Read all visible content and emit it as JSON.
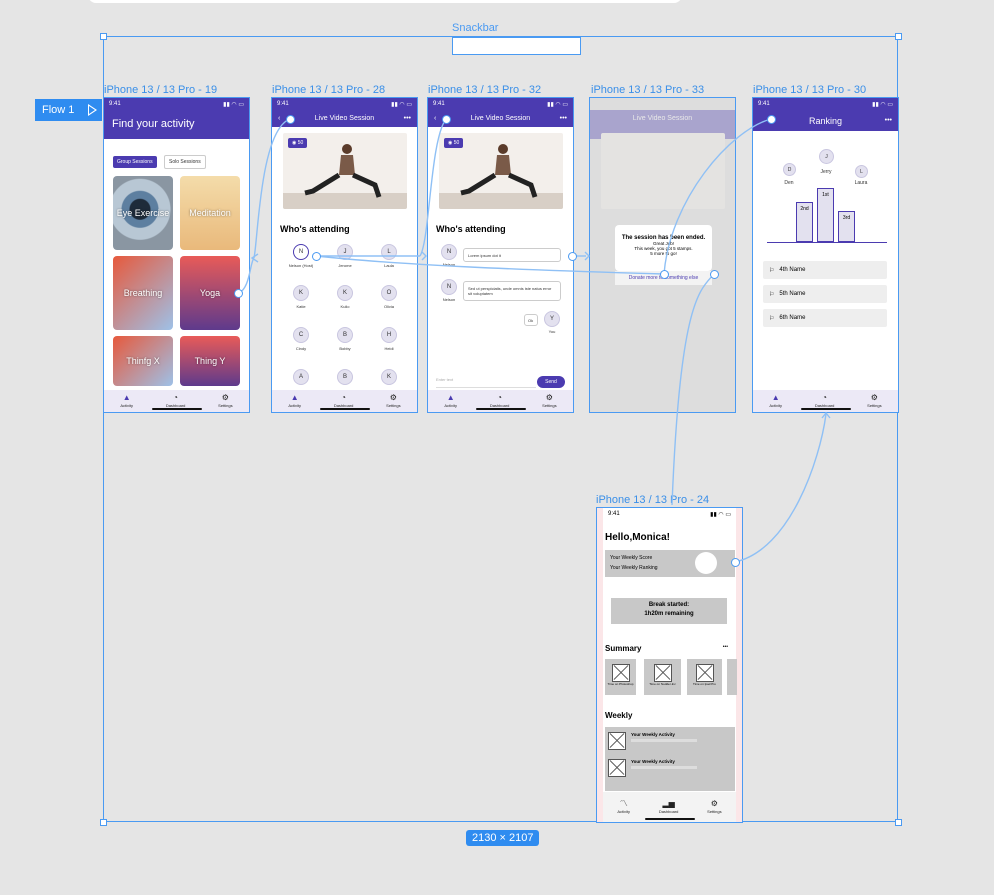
{
  "canvas": {
    "snackbar_label": "Snackbar",
    "dimensions_badge": "2130 × 2107",
    "flow_label": "Flow 1"
  },
  "frames": {
    "f19": {
      "label": "iPhone 13 / 13 Pro - 19",
      "time": "9:41",
      "title": "Find your activity",
      "toggle_group": "Group Sessions",
      "toggle_solo": "Solo Sessions",
      "cards": [
        "Eye Exercise",
        "Meditation",
        "Breathing",
        "Yoga",
        "Thinfg X",
        "Thing Y"
      ]
    },
    "f28": {
      "label": "iPhone 13 / 13 Pro - 28",
      "time": "9:41",
      "title": "Live Video Session",
      "more": "•••",
      "viewers": "50",
      "attending_heading": "Who's attending",
      "attendees": [
        {
          "initial": "N",
          "name": "Nelson (Host)"
        },
        {
          "initial": "J",
          "name": "Jerome"
        },
        {
          "initial": "L",
          "name": "Laula"
        },
        {
          "initial": "K",
          "name": "Katie"
        },
        {
          "initial": "K",
          "name": "Kulio"
        },
        {
          "initial": "O",
          "name": "Olivia"
        },
        {
          "initial": "C",
          "name": "Cindy"
        },
        {
          "initial": "B",
          "name": "Bobby"
        },
        {
          "initial": "H",
          "name": "Heidi"
        },
        {
          "initial": "A",
          "name": ""
        },
        {
          "initial": "B",
          "name": ""
        },
        {
          "initial": "K",
          "name": ""
        }
      ]
    },
    "f32": {
      "label": "iPhone 13 / 13 Pro - 32",
      "time": "9:41",
      "title": "Live Video Session",
      "more": "•••",
      "viewers": "50",
      "attending_heading": "Who's attending",
      "chat": [
        {
          "initial": "N",
          "name": "Nelson",
          "text": "Lorem ipsum dot it"
        },
        {
          "initial": "N",
          "name": "Nelson",
          "text": "Sed ut perspiciatis, unde omnis iste natus error sit voluptatem"
        }
      ],
      "reply_text": "Ok",
      "reply_initial": "Y",
      "reply_name": "You",
      "input_placeholder": "Enter text",
      "send_label": "Send"
    },
    "f33": {
      "label": "iPhone 13 / 13 Pro - 33",
      "title": "Live Video Session",
      "dialog_title": "The session has been ended.",
      "dialog_line1": "Great Job!",
      "dialog_line2": "This week, you got 5 stamps.",
      "dialog_line3": "5 more to go!",
      "dialog_link": "Donate more to something else"
    },
    "f30": {
      "label": "iPhone 13 / 13 Pro - 30",
      "time": "9:41",
      "title": "Ranking",
      "more": "•••",
      "podium_people": [
        {
          "initial": "D",
          "name": "Den"
        },
        {
          "initial": "J",
          "name": "Jerry"
        },
        {
          "initial": "L",
          "name": "Laura"
        }
      ],
      "podium_labels": [
        "2nd",
        "1st",
        "3rd"
      ],
      "rows": [
        "4th Name",
        "5th Name",
        "6th Name"
      ]
    },
    "f24": {
      "label": "iPhone 13 / 13 Pro - 24",
      "time": "9:41",
      "greeting": "Hello,Monica!",
      "score_label": "Your Weekly Score",
      "ranking_label": "Your Weekly Ranking",
      "break_line1": "Break started:",
      "break_line2": "1h20m remaining",
      "summary_heading": "Summary",
      "summary_more": "•••",
      "summary_items": [
        "Time on Photoshop",
        "Time on Nodder-Inc",
        "Time on Ipad Pro"
      ],
      "weekly_heading": "Weekly",
      "weekly_items": [
        "Your Weekly Activity",
        "Your Weekly Activity"
      ]
    }
  },
  "tabs": {
    "activity": "Activity",
    "dashboard": "Dashboard",
    "settings": "Settings"
  },
  "colors": {
    "accent": "#4b3bb0",
    "selection": "#4a9af2"
  }
}
